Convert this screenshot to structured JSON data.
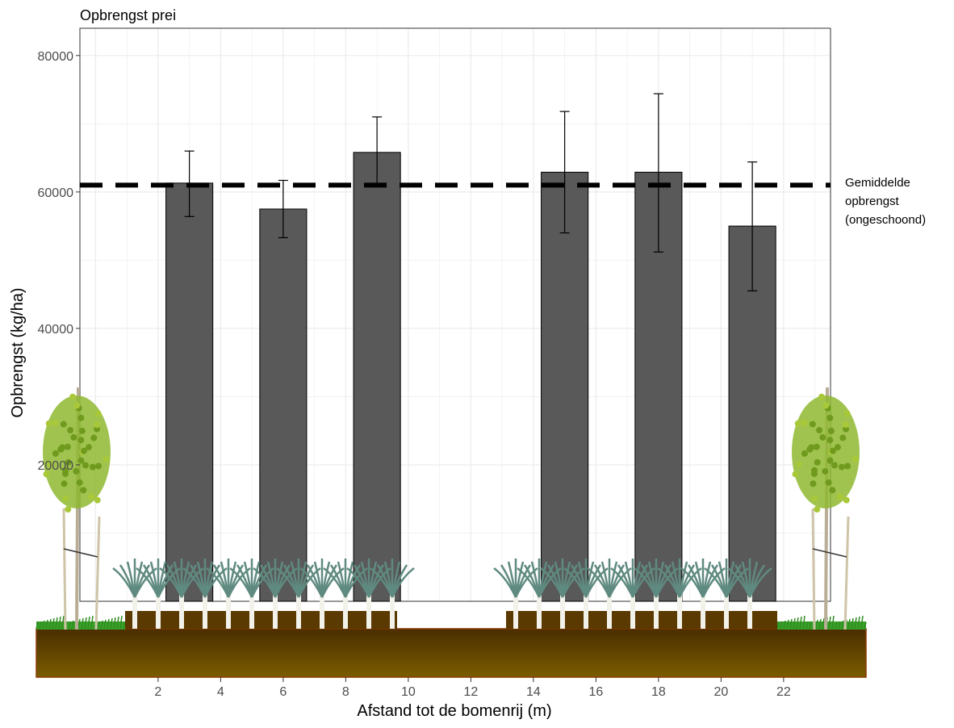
{
  "chart_data": {
    "type": "bar",
    "title": "Opbrengst prei",
    "xlabel": "Afstand tot de bomenrij (m)",
    "ylabel": "Opbrengst (kg/ha)",
    "x": [
      3,
      6,
      9,
      15,
      18,
      21
    ],
    "values": [
      61300,
      57500,
      65800,
      62900,
      62900,
      55000
    ],
    "error_low": [
      56400,
      53300,
      61000,
      54000,
      51200,
      45500
    ],
    "error_high": [
      66000,
      61700,
      71000,
      71800,
      74400,
      64400
    ],
    "bar_width": 1.5,
    "reference_line": {
      "value": 61000,
      "style": "dashed"
    },
    "annotation": [
      "Gemiddelde",
      "opbrengst",
      "(ongeschoond)"
    ],
    "xlim": [
      -0.5,
      23.5
    ],
    "ylim": [
      0,
      84000
    ],
    "x_ticks": [
      "2",
      "4",
      "6",
      "8",
      "10",
      "12",
      "14",
      "16",
      "18",
      "20",
      "22"
    ],
    "y_ticks": [
      "20000",
      "40000",
      "60000",
      "80000"
    ],
    "grid": true,
    "colors": {
      "bar_fill": "#595959",
      "bar_stroke": "#000000",
      "grid": "#ebebeb",
      "soil_top": "#4a2e00",
      "soil_bottom": "#7a5c00",
      "soil_border": "#8b3a00",
      "grass": "#3aa02a",
      "leek": "#5f8a80",
      "tree": "#8fb830"
    }
  }
}
